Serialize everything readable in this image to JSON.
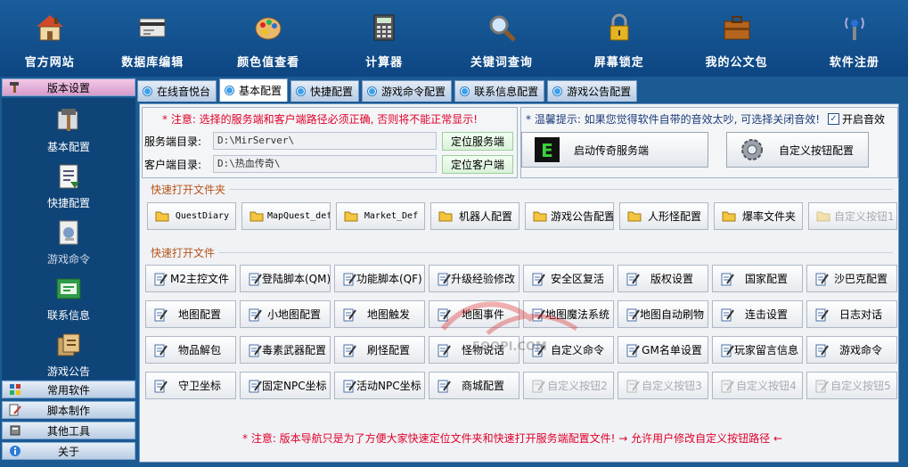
{
  "toolbar": [
    {
      "label": "官方网站",
      "icon": "house-icon"
    },
    {
      "label": "数据库编辑",
      "icon": "database-card-icon"
    },
    {
      "label": "颜色值查看",
      "icon": "palette-icon"
    },
    {
      "label": "计算器",
      "icon": "calculator-icon"
    },
    {
      "label": "关键词查询",
      "icon": "magnifier-icon"
    },
    {
      "label": "屏幕锁定",
      "icon": "padlock-icon"
    },
    {
      "label": "我的公文包",
      "icon": "briefcase-icon"
    },
    {
      "label": "软件注册",
      "icon": "antenna-icon"
    }
  ],
  "sidebar": {
    "sections": [
      {
        "label": "版本设置",
        "icon": "hammer-icon",
        "active": true
      },
      {
        "label": "常用软件",
        "icon": "apps-icon"
      },
      {
        "label": "脚本制作",
        "icon": "pencil-doc-icon"
      },
      {
        "label": "其他工具",
        "icon": "tools-icon"
      },
      {
        "label": "关于",
        "icon": "info-icon"
      }
    ],
    "items": [
      {
        "label": "基本配置",
        "icon": "hammer-config-icon"
      },
      {
        "label": "快捷配置",
        "icon": "shortcut-doc-icon"
      },
      {
        "label": "游戏命令",
        "icon": "command-doc-icon"
      },
      {
        "label": "联系信息",
        "icon": "contact-icon"
      },
      {
        "label": "游戏公告",
        "icon": "notice-icon"
      }
    ]
  },
  "tabs": [
    {
      "label": "在线音悦台",
      "active": false
    },
    {
      "label": "基本配置",
      "active": true
    },
    {
      "label": "快捷配置",
      "active": false
    },
    {
      "label": "游戏命令配置",
      "active": false
    },
    {
      "label": "联系信息配置",
      "active": false
    },
    {
      "label": "游戏公告配置",
      "active": false
    }
  ],
  "paths": {
    "warning": "* 注意: 选择的服务端和客户端路径必须正确, 否则将不能正常显示!",
    "server_label": "服务端目录:",
    "server_value": "D:\\MirServer\\",
    "server_button": "定位服务端",
    "client_label": "客户端目录:",
    "client_value": "D:\\热血传奇\\",
    "client_button": "定位客户端"
  },
  "sound": {
    "hint": "* 温馨提示: 如果您觉得软件自带的音效太吵, 可选择关闭音效!",
    "checkbox_label": "开启音效",
    "checked": true,
    "start_server_button": "启动传奇服务端",
    "custom_config_button": "自定义按钮配置"
  },
  "folders": {
    "title": "快速打开文件夹",
    "buttons": [
      {
        "label": "QuestDiary",
        "mono": true
      },
      {
        "label": "MapQuest_def",
        "mono": true
      },
      {
        "label": "Market_Def",
        "mono": true
      },
      {
        "label": "机器人配置"
      },
      {
        "label": "游戏公告配置"
      },
      {
        "label": "人形怪配置"
      },
      {
        "label": "爆率文件夹"
      },
      {
        "label": "自定义按钮1",
        "disabled": true
      }
    ]
  },
  "files": {
    "title": "快速打开文件",
    "rows": [
      [
        "M2主控文件",
        "登陆脚本(QM)",
        "功能脚本(QF)",
        "升级经验修改",
        "安全区复活",
        "版权设置",
        "国家配置",
        "沙巴克配置"
      ],
      [
        "地图配置",
        "小地图配置",
        "地图触发",
        "地图事件",
        "地图魔法系统",
        "地图自动刷物",
        "连击设置",
        "日志对话"
      ],
      [
        "物品解包",
        "毒素武器配置",
        "刷怪配置",
        "怪物说话",
        "自定义命令",
        "GM名单设置",
        "玩家留言信息",
        "游戏命令"
      ],
      [
        "守卫坐标",
        "固定NPC坐标",
        "活动NPC坐标",
        "商城配置",
        "自定义按钮2",
        "自定义按钮3",
        "自定义按钮4",
        "自定义按钮5"
      ]
    ],
    "disabled": [
      "自定义按钮2",
      "自定义按钮3",
      "自定义按钮4",
      "自定义按钮5"
    ]
  },
  "footer": "* 注意: 版本导航只是为了方便大家快速定位文件夹和快速打开服务端配置文件! → 允许用户修改自定义按钮路径 ←",
  "watermark": "5OOPI.COM"
}
